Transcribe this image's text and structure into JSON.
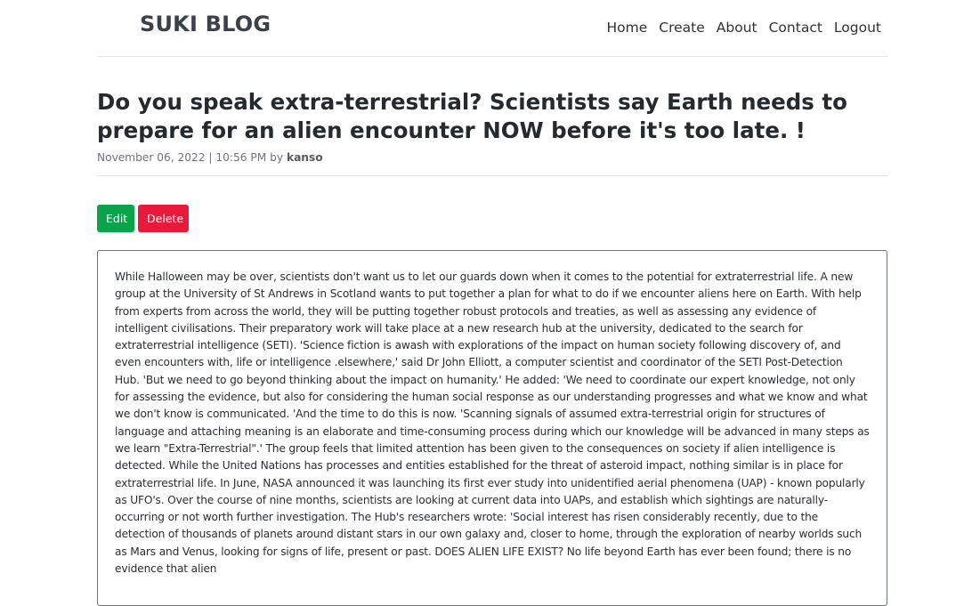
{
  "header": {
    "brand": "SUKI BLOG",
    "nav": [
      "Home",
      "Create",
      "About",
      "Contact",
      "Logout"
    ]
  },
  "post": {
    "title": "Do you speak extra-terrestrial? Scientists say Earth needs to prepare for an alien encounter NOW before it's too late. !",
    "date": "November 06, 2022 | 10:56 PM",
    "by_label": "by",
    "author": "kanso",
    "body": "While Halloween may be over, scientists don't want us to let our guards down when it comes to the potential for extraterrestrial life. A new group at the University of St Andrews in Scotland wants to put together a plan for what to do if we encounter aliens here on Earth. With help from experts from across the world, they will be putting together robust protocols and treaties, as well as assessing any evidence of intelligent civilisations. Their preparatory work will take place at a new research hub at the university, dedicated to the search for extraterrestrial intelligence (SETI). 'Science fiction is awash with explorations of the impact on human society following discovery of, and even encounters with, life or intelligence .elsewhere,' said Dr John Elliott, a computer scientist and coordinator of the SETI Post-Detection Hub. 'But we need to go beyond thinking about the impact on humanity.' He added: 'We need to coordinate our expert knowledge, not only for assessing the evidence, but also for considering the human social response as our understanding progresses and what we know and what we don't know is communicated. 'And the time to do this is now. 'Scanning signals of assumed extra-terrestrial origin for structures of language and attaching meaning is an elaborate and time-consuming process during which our knowledge will be advanced in many steps as we learn \"Extra-Terrestrial\".' The group feels that limited attention has been given to the consequences on society if alien intelligence is detected. While the United Nations has processes and entities established for the threat of asteroid impact, nothing similar is in place for extraterrestrial life. In June, NASA announced it was launching its first ever study into unidentified aerial phenomena (UAP) - known popularly as UFO's. Over the course of nine months, scientists are looking at current data into UAPs, and establish which sightings are naturally-occurring or not worth further investigation. The Hub's researchers wrote: 'Social interest has risen considerably recently, due to the detection of thousands of planets around distant stars in our own galaxy and, closer to home, through the exploration of nearby worlds such as Mars and Venus, looking for signs of life, present or past. DOES ALIEN LIFE EXIST? No life beyond Earth has ever been found; there is no evidence that alien"
  },
  "actions": {
    "edit_label": "Edit",
    "delete_label": "Delete"
  },
  "colors": {
    "edit": "#0ca44a",
    "delete": "#e8193b"
  }
}
